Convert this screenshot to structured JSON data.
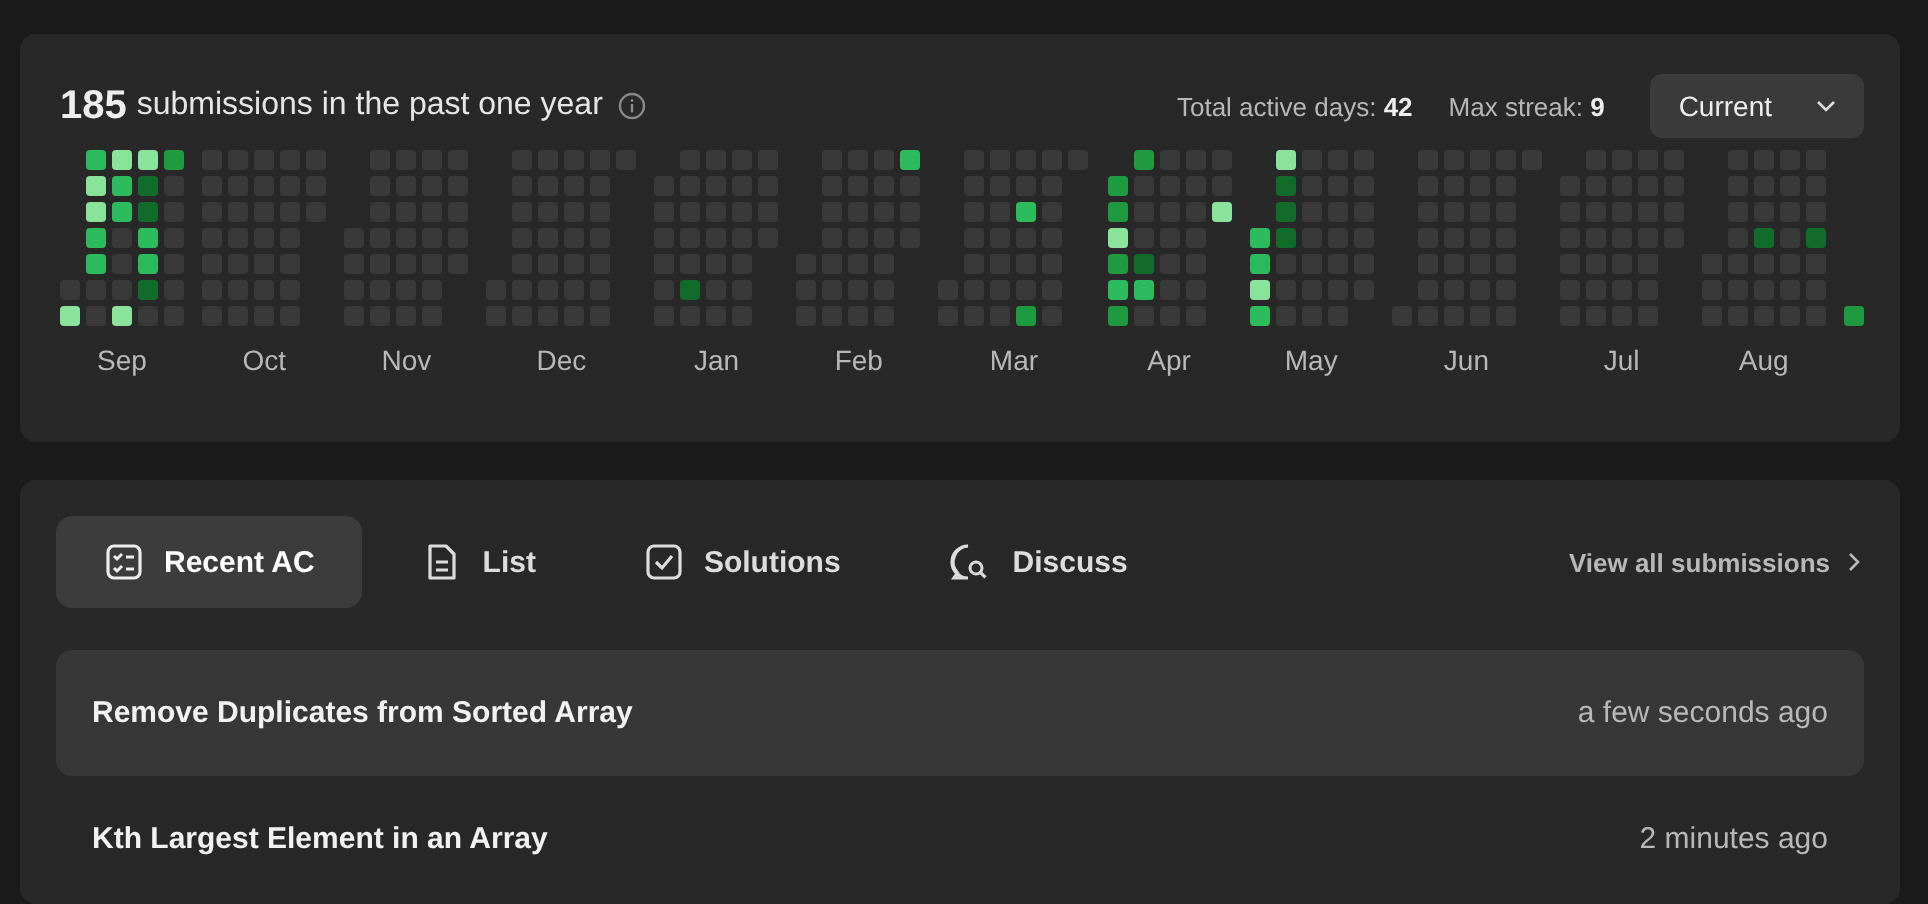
{
  "header": {
    "count": "185",
    "caption": "submissions in the past one year",
    "stats": [
      {
        "label": "Total active days:",
        "value": "42"
      },
      {
        "label": "Max streak:",
        "value": "9"
      }
    ],
    "period": "Current"
  },
  "calendar": {
    "months": [
      {
        "label": "Sep",
        "weeks": [
          [
            {
              "color": "#393939"
            },
            {
              "color": "#8ae39a"
            }
          ],
          [
            {
              "color": "#2cbb5d"
            },
            {
              "color": "#8ae39a"
            },
            {
              "color": "#8ae39a"
            },
            {
              "color": "#2cbb5d"
            },
            {
              "color": "#2cbb5d"
            },
            {
              "color": "#393939"
            },
            {
              "color": "#393939"
            }
          ],
          [
            {
              "color": "#8ae39a"
            },
            {
              "color": "#2cbb5d"
            },
            {
              "color": "#2cbb5d"
            },
            {
              "color": "#393939"
            },
            {
              "color": "#393939"
            },
            {
              "color": "#393939"
            },
            {
              "color": "#8ae39a"
            }
          ],
          [
            {
              "color": "#8ae39a"
            },
            {
              "color": "#116b2a"
            },
            {
              "color": "#116b2a"
            },
            {
              "color": "#2cbb5d"
            },
            {
              "color": "#2cbb5d"
            },
            {
              "color": "#116b2a"
            },
            {
              "color": "#393939"
            }
          ],
          [
            {
              "color": "#1e9a40"
            },
            {
              "color": "#393939"
            },
            {
              "color": "#393939"
            },
            {
              "color": "#393939"
            },
            {
              "color": "#393939"
            },
            {
              "color": "#393939"
            },
            {
              "color": "#393939"
            }
          ]
        ]
      },
      {
        "label": "Oct",
        "weeks": [
          [
            {
              "color": "#393939"
            },
            {
              "color": "#393939"
            },
            {
              "color": "#393939"
            },
            {
              "color": "#393939"
            },
            {
              "color": "#393939"
            },
            {
              "color": "#393939"
            },
            {
              "color": "#393939"
            }
          ],
          [
            {
              "color": "#393939"
            },
            {
              "color": "#393939"
            },
            {
              "color": "#393939"
            },
            {
              "color": "#393939"
            },
            {
              "color": "#393939"
            },
            {
              "color": "#393939"
            },
            {
              "color": "#393939"
            }
          ],
          [
            {
              "color": "#393939"
            },
            {
              "color": "#393939"
            },
            {
              "color": "#393939"
            },
            {
              "color": "#393939"
            },
            {
              "color": "#393939"
            },
            {
              "color": "#393939"
            },
            {
              "color": "#393939"
            }
          ],
          [
            {
              "color": "#393939"
            },
            {
              "color": "#393939"
            },
            {
              "color": "#393939"
            },
            {
              "color": "#393939"
            },
            {
              "color": "#393939"
            },
            {
              "color": "#393939"
            },
            {
              "color": "#393939"
            }
          ],
          [
            {
              "color": "#393939"
            },
            {
              "color": "#393939"
            },
            {
              "color": "#393939"
            }
          ]
        ]
      },
      {
        "label": "Nov",
        "weeks": [
          [
            {
              "color": "#393939"
            },
            {
              "color": "#393939"
            },
            {
              "color": "#393939"
            },
            {
              "color": "#393939"
            }
          ],
          [
            {
              "color": "#393939"
            },
            {
              "color": "#393939"
            },
            {
              "color": "#393939"
            },
            {
              "color": "#393939"
            },
            {
              "color": "#393939"
            },
            {
              "color": "#393939"
            },
            {
              "color": "#393939"
            }
          ],
          [
            {
              "color": "#393939"
            },
            {
              "color": "#393939"
            },
            {
              "color": "#393939"
            },
            {
              "color": "#393939"
            },
            {
              "color": "#393939"
            },
            {
              "color": "#393939"
            },
            {
              "color": "#393939"
            }
          ],
          [
            {
              "color": "#393939"
            },
            {
              "color": "#393939"
            },
            {
              "color": "#393939"
            },
            {
              "color": "#393939"
            },
            {
              "color": "#393939"
            },
            {
              "color": "#393939"
            },
            {
              "color": "#393939"
            }
          ],
          [
            {
              "color": "#393939"
            },
            {
              "color": "#393939"
            },
            {
              "color": "#393939"
            },
            {
              "color": "#393939"
            },
            {
              "color": "#393939"
            }
          ]
        ]
      },
      {
        "label": "Dec",
        "weeks": [
          [
            {
              "color": "#393939"
            },
            {
              "color": "#393939"
            }
          ],
          [
            {
              "color": "#393939"
            },
            {
              "color": "#393939"
            },
            {
              "color": "#393939"
            },
            {
              "color": "#393939"
            },
            {
              "color": "#393939"
            },
            {
              "color": "#393939"
            },
            {
              "color": "#393939"
            }
          ],
          [
            {
              "color": "#393939"
            },
            {
              "color": "#393939"
            },
            {
              "color": "#393939"
            },
            {
              "color": "#393939"
            },
            {
              "color": "#393939"
            },
            {
              "color": "#393939"
            },
            {
              "color": "#393939"
            }
          ],
          [
            {
              "color": "#393939"
            },
            {
              "color": "#393939"
            },
            {
              "color": "#393939"
            },
            {
              "color": "#393939"
            },
            {
              "color": "#393939"
            },
            {
              "color": "#393939"
            },
            {
              "color": "#393939"
            }
          ],
          [
            {
              "color": "#393939"
            },
            {
              "color": "#393939"
            },
            {
              "color": "#393939"
            },
            {
              "color": "#393939"
            },
            {
              "color": "#393939"
            },
            {
              "color": "#393939"
            },
            {
              "color": "#393939"
            }
          ],
          [
            {
              "color": "#393939"
            }
          ]
        ]
      },
      {
        "label": "Jan",
        "weeks": [
          [
            {
              "color": "#393939"
            },
            {
              "color": "#393939"
            },
            {
              "color": "#393939"
            },
            {
              "color": "#393939"
            },
            {
              "color": "#393939"
            },
            {
              "color": "#393939"
            }
          ],
          [
            {
              "color": "#393939"
            },
            {
              "color": "#393939"
            },
            {
              "color": "#393939"
            },
            {
              "color": "#393939"
            },
            {
              "color": "#393939"
            },
            {
              "color": "#116b2a"
            },
            {
              "color": "#393939"
            }
          ],
          [
            {
              "color": "#393939"
            },
            {
              "color": "#393939"
            },
            {
              "color": "#393939"
            },
            {
              "color": "#393939"
            },
            {
              "color": "#393939"
            },
            {
              "color": "#393939"
            },
            {
              "color": "#393939"
            }
          ],
          [
            {
              "color": "#393939"
            },
            {
              "color": "#393939"
            },
            {
              "color": "#393939"
            },
            {
              "color": "#393939"
            },
            {
              "color": "#393939"
            },
            {
              "color": "#393939"
            },
            {
              "color": "#393939"
            }
          ],
          [
            {
              "color": "#393939"
            },
            {
              "color": "#393939"
            },
            {
              "color": "#393939"
            },
            {
              "color": "#393939"
            }
          ]
        ]
      },
      {
        "label": "Feb",
        "weeks": [
          [
            {
              "color": "#393939"
            },
            {
              "color": "#393939"
            },
            {
              "color": "#393939"
            }
          ],
          [
            {
              "color": "#393939"
            },
            {
              "color": "#393939"
            },
            {
              "color": "#393939"
            },
            {
              "color": "#393939"
            },
            {
              "color": "#393939"
            },
            {
              "color": "#393939"
            },
            {
              "color": "#393939"
            }
          ],
          [
            {
              "color": "#393939"
            },
            {
              "color": "#393939"
            },
            {
              "color": "#393939"
            },
            {
              "color": "#393939"
            },
            {
              "color": "#393939"
            },
            {
              "color": "#393939"
            },
            {
              "color": "#393939"
            }
          ],
          [
            {
              "color": "#393939"
            },
            {
              "color": "#393939"
            },
            {
              "color": "#393939"
            },
            {
              "color": "#393939"
            },
            {
              "color": "#393939"
            },
            {
              "color": "#393939"
            },
            {
              "color": "#393939"
            }
          ],
          [
            {
              "color": "#2cbb5d"
            },
            {
              "color": "#393939"
            },
            {
              "color": "#393939"
            },
            {
              "color": "#393939"
            }
          ]
        ]
      },
      {
        "label": "Mar",
        "weeks": [
          [
            {
              "color": "#393939"
            },
            {
              "color": "#393939"
            }
          ],
          [
            {
              "color": "#393939"
            },
            {
              "color": "#393939"
            },
            {
              "color": "#393939"
            },
            {
              "color": "#393939"
            },
            {
              "color": "#393939"
            },
            {
              "color": "#393939"
            },
            {
              "color": "#393939"
            }
          ],
          [
            {
              "color": "#393939"
            },
            {
              "color": "#393939"
            },
            {
              "color": "#393939"
            },
            {
              "color": "#393939"
            },
            {
              "color": "#393939"
            },
            {
              "color": "#393939"
            },
            {
              "color": "#393939"
            }
          ],
          [
            {
              "color": "#393939"
            },
            {
              "color": "#393939"
            },
            {
              "color": "#2cbb5d"
            },
            {
              "color": "#393939"
            },
            {
              "color": "#393939"
            },
            {
              "color": "#393939"
            },
            {
              "color": "#1e9a40"
            }
          ],
          [
            {
              "color": "#393939"
            },
            {
              "color": "#393939"
            },
            {
              "color": "#393939"
            },
            {
              "color": "#393939"
            },
            {
              "color": "#393939"
            },
            {
              "color": "#393939"
            },
            {
              "color": "#393939"
            }
          ],
          [
            {
              "color": "#393939"
            }
          ]
        ]
      },
      {
        "label": "Apr",
        "weeks": [
          [
            {
              "color": "#1e9a40"
            },
            {
              "color": "#1e9a40"
            },
            {
              "color": "#8ae39a"
            },
            {
              "color": "#1e9a40"
            },
            {
              "color": "#2cbb5d"
            },
            {
              "color": "#1e9a40"
            }
          ],
          [
            {
              "color": "#1e9a40"
            },
            {
              "color": "#393939"
            },
            {
              "color": "#393939"
            },
            {
              "color": "#393939"
            },
            {
              "color": "#116b2a"
            },
            {
              "color": "#2cbb5d"
            },
            {
              "color": "#393939"
            }
          ],
          [
            {
              "color": "#393939"
            },
            {
              "color": "#393939"
            },
            {
              "color": "#393939"
            },
            {
              "color": "#393939"
            },
            {
              "color": "#393939"
            },
            {
              "color": "#393939"
            },
            {
              "color": "#393939"
            }
          ],
          [
            {
              "color": "#393939"
            },
            {
              "color": "#393939"
            },
            {
              "color": "#393939"
            },
            {
              "color": "#393939"
            },
            {
              "color": "#393939"
            },
            {
              "color": "#393939"
            },
            {
              "color": "#393939"
            }
          ],
          [
            {
              "color": "#393939"
            },
            {
              "color": "#393939"
            },
            {
              "color": "#8ae39a"
            }
          ]
        ]
      },
      {
        "label": "May",
        "weeks": [
          [
            {
              "color": "#2cbb5d"
            },
            {
              "color": "#2cbb5d"
            },
            {
              "color": "#8ae39a"
            },
            {
              "color": "#2cbb5d"
            }
          ],
          [
            {
              "color": "#8ae39a"
            },
            {
              "color": "#116b2a"
            },
            {
              "color": "#116b2a"
            },
            {
              "color": "#116b2a"
            },
            {
              "color": "#393939"
            },
            {
              "color": "#393939"
            },
            {
              "color": "#393939"
            }
          ],
          [
            {
              "color": "#393939"
            },
            {
              "color": "#393939"
            },
            {
              "color": "#393939"
            },
            {
              "color": "#393939"
            },
            {
              "color": "#393939"
            },
            {
              "color": "#393939"
            },
            {
              "color": "#393939"
            }
          ],
          [
            {
              "color": "#393939"
            },
            {
              "color": "#393939"
            },
            {
              "color": "#393939"
            },
            {
              "color": "#393939"
            },
            {
              "color": "#393939"
            },
            {
              "color": "#393939"
            },
            {
              "color": "#393939"
            }
          ],
          [
            {
              "color": "#393939"
            },
            {
              "color": "#393939"
            },
            {
              "color": "#393939"
            },
            {
              "color": "#393939"
            },
            {
              "color": "#393939"
            },
            {
              "color": "#393939"
            }
          ]
        ]
      },
      {
        "label": "Jun",
        "weeks": [
          [
            {
              "color": "#393939"
            }
          ],
          [
            {
              "color": "#393939"
            },
            {
              "color": "#393939"
            },
            {
              "color": "#393939"
            },
            {
              "color": "#393939"
            },
            {
              "color": "#393939"
            },
            {
              "color": "#393939"
            },
            {
              "color": "#393939"
            }
          ],
          [
            {
              "color": "#393939"
            },
            {
              "color": "#393939"
            },
            {
              "color": "#393939"
            },
            {
              "color": "#393939"
            },
            {
              "color": "#393939"
            },
            {
              "color": "#393939"
            },
            {
              "color": "#393939"
            }
          ],
          [
            {
              "color": "#393939"
            },
            {
              "color": "#393939"
            },
            {
              "color": "#393939"
            },
            {
              "color": "#393939"
            },
            {
              "color": "#393939"
            },
            {
              "color": "#393939"
            },
            {
              "color": "#393939"
            }
          ],
          [
            {
              "color": "#393939"
            },
            {
              "color": "#393939"
            },
            {
              "color": "#393939"
            },
            {
              "color": "#393939"
            },
            {
              "color": "#393939"
            },
            {
              "color": "#393939"
            },
            {
              "color": "#393939"
            }
          ],
          [
            {
              "color": "#393939"
            }
          ]
        ]
      },
      {
        "label": "Jul",
        "weeks": [
          [
            {
              "color": "#393939"
            },
            {
              "color": "#393939"
            },
            {
              "color": "#393939"
            },
            {
              "color": "#393939"
            },
            {
              "color": "#393939"
            },
            {
              "color": "#393939"
            }
          ],
          [
            {
              "color": "#393939"
            },
            {
              "color": "#393939"
            },
            {
              "color": "#393939"
            },
            {
              "color": "#393939"
            },
            {
              "color": "#393939"
            },
            {
              "color": "#393939"
            },
            {
              "color": "#393939"
            }
          ],
          [
            {
              "color": "#393939"
            },
            {
              "color": "#393939"
            },
            {
              "color": "#393939"
            },
            {
              "color": "#393939"
            },
            {
              "color": "#393939"
            },
            {
              "color": "#393939"
            },
            {
              "color": "#393939"
            }
          ],
          [
            {
              "color": "#393939"
            },
            {
              "color": "#393939"
            },
            {
              "color": "#393939"
            },
            {
              "color": "#393939"
            },
            {
              "color": "#393939"
            },
            {
              "color": "#393939"
            },
            {
              "color": "#393939"
            }
          ],
          [
            {
              "color": "#393939"
            },
            {
              "color": "#393939"
            },
            {
              "color": "#393939"
            },
            {
              "color": "#393939"
            }
          ]
        ]
      },
      {
        "label": "Aug",
        "weeks": [
          [
            {
              "color": "#393939"
            },
            {
              "color": "#393939"
            },
            {
              "color": "#393939"
            }
          ],
          [
            {
              "color": "#393939"
            },
            {
              "color": "#393939"
            },
            {
              "color": "#393939"
            },
            {
              "color": "#393939"
            },
            {
              "color": "#393939"
            },
            {
              "color": "#393939"
            },
            {
              "color": "#393939"
            }
          ],
          [
            {
              "color": "#393939"
            },
            {
              "color": "#393939"
            },
            {
              "color": "#393939"
            },
            {
              "color": "#116b2a"
            },
            {
              "color": "#393939"
            },
            {
              "color": "#393939"
            },
            {
              "color": "#393939"
            }
          ],
          [
            {
              "color": "#393939"
            },
            {
              "color": "#393939"
            },
            {
              "color": "#393939"
            },
            {
              "color": "#393939"
            },
            {
              "color": "#393939"
            },
            {
              "color": "#393939"
            },
            {
              "color": "#393939"
            }
          ],
          [
            {
              "color": "#393939"
            },
            {
              "color": "#393939"
            },
            {
              "color": "#393939"
            },
            {
              "color": "#116b2a"
            },
            {
              "color": "#393939"
            },
            {
              "color": "#393939"
            },
            {
              "color": "#393939"
            }
          ]
        ]
      },
      {
        "weeks": [
          [
            {
              "color": "#1e9a40"
            }
          ]
        ]
      }
    ]
  },
  "tabs": [
    {
      "label": "Recent AC",
      "kind": "checklist",
      "selected": true
    },
    {
      "label": "List",
      "kind": "document",
      "selected": false
    },
    {
      "label": "Solutions",
      "kind": "checkbox",
      "selected": false
    },
    {
      "label": "Discuss",
      "kind": "discuss",
      "selected": false
    }
  ],
  "view_all": "View all submissions",
  "submissions": [
    {
      "title": "Remove Duplicates from Sorted Array",
      "time": "a few seconds ago"
    },
    {
      "title": "Kth Largest Element in an Array",
      "time": "2 minutes ago"
    }
  ]
}
